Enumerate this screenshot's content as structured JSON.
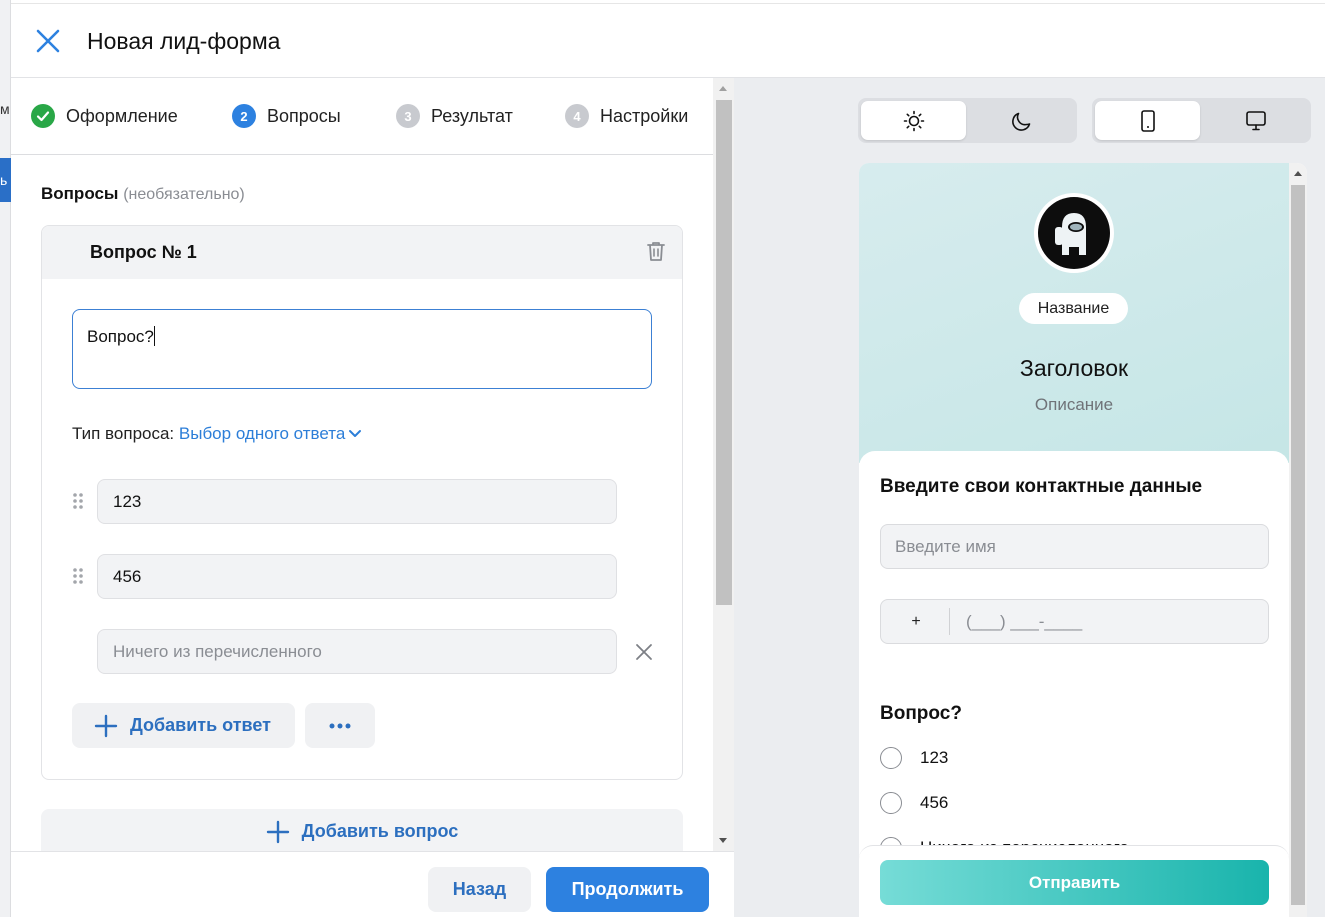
{
  "backdrop": {
    "letter_m": "м",
    "blue_letter": "ь"
  },
  "header": {
    "title": "Новая лид-форма"
  },
  "steps": [
    {
      "num": "✓",
      "label": "Оформление",
      "state": "done"
    },
    {
      "num": "2",
      "label": "Вопросы",
      "state": "active"
    },
    {
      "num": "3",
      "label": "Результат",
      "state": "idle"
    },
    {
      "num": "4",
      "label": "Настройки",
      "state": "idle"
    }
  ],
  "questions": {
    "title": "Вопросы",
    "optional": "(необязательно)",
    "card": {
      "title": "Вопрос № 1",
      "question_value": "Вопрос?",
      "type_label": "Тип вопроса:",
      "type_value": "Выбор одного ответа",
      "answers": [
        "123",
        "456"
      ],
      "none_placeholder": "Ничего из перечисленного",
      "add_answer": "Добавить ответ"
    },
    "add_question": "Добавить вопрос"
  },
  "footer": {
    "back": "Назад",
    "next": "Продолжить"
  },
  "preview": {
    "badge": "Название",
    "headline": "Заголовок",
    "description": "Описание",
    "contact_title": "Введите свои контактные данные",
    "name_placeholder": "Введите имя",
    "phone_plus": "+",
    "phone_mask": "(___) ___-____",
    "question": "Вопрос?",
    "options": [
      "123",
      "456",
      "Ничего из перечисленного"
    ],
    "submit": "Отправить"
  },
  "colors": {
    "accent": "#2d81e0",
    "link": "#2c7ed8",
    "done": "#29a747",
    "submit_start": "#76dcd7",
    "submit_end": "#19b4ac"
  },
  "icons": {
    "close": "close-icon",
    "trash": "trash-icon",
    "drag": "drag-handle-icon",
    "plus": "plus-icon",
    "more": "more-dots-icon",
    "sun": "sun-icon",
    "moon": "moon-icon",
    "mobile": "mobile-icon",
    "desktop": "desktop-icon"
  }
}
